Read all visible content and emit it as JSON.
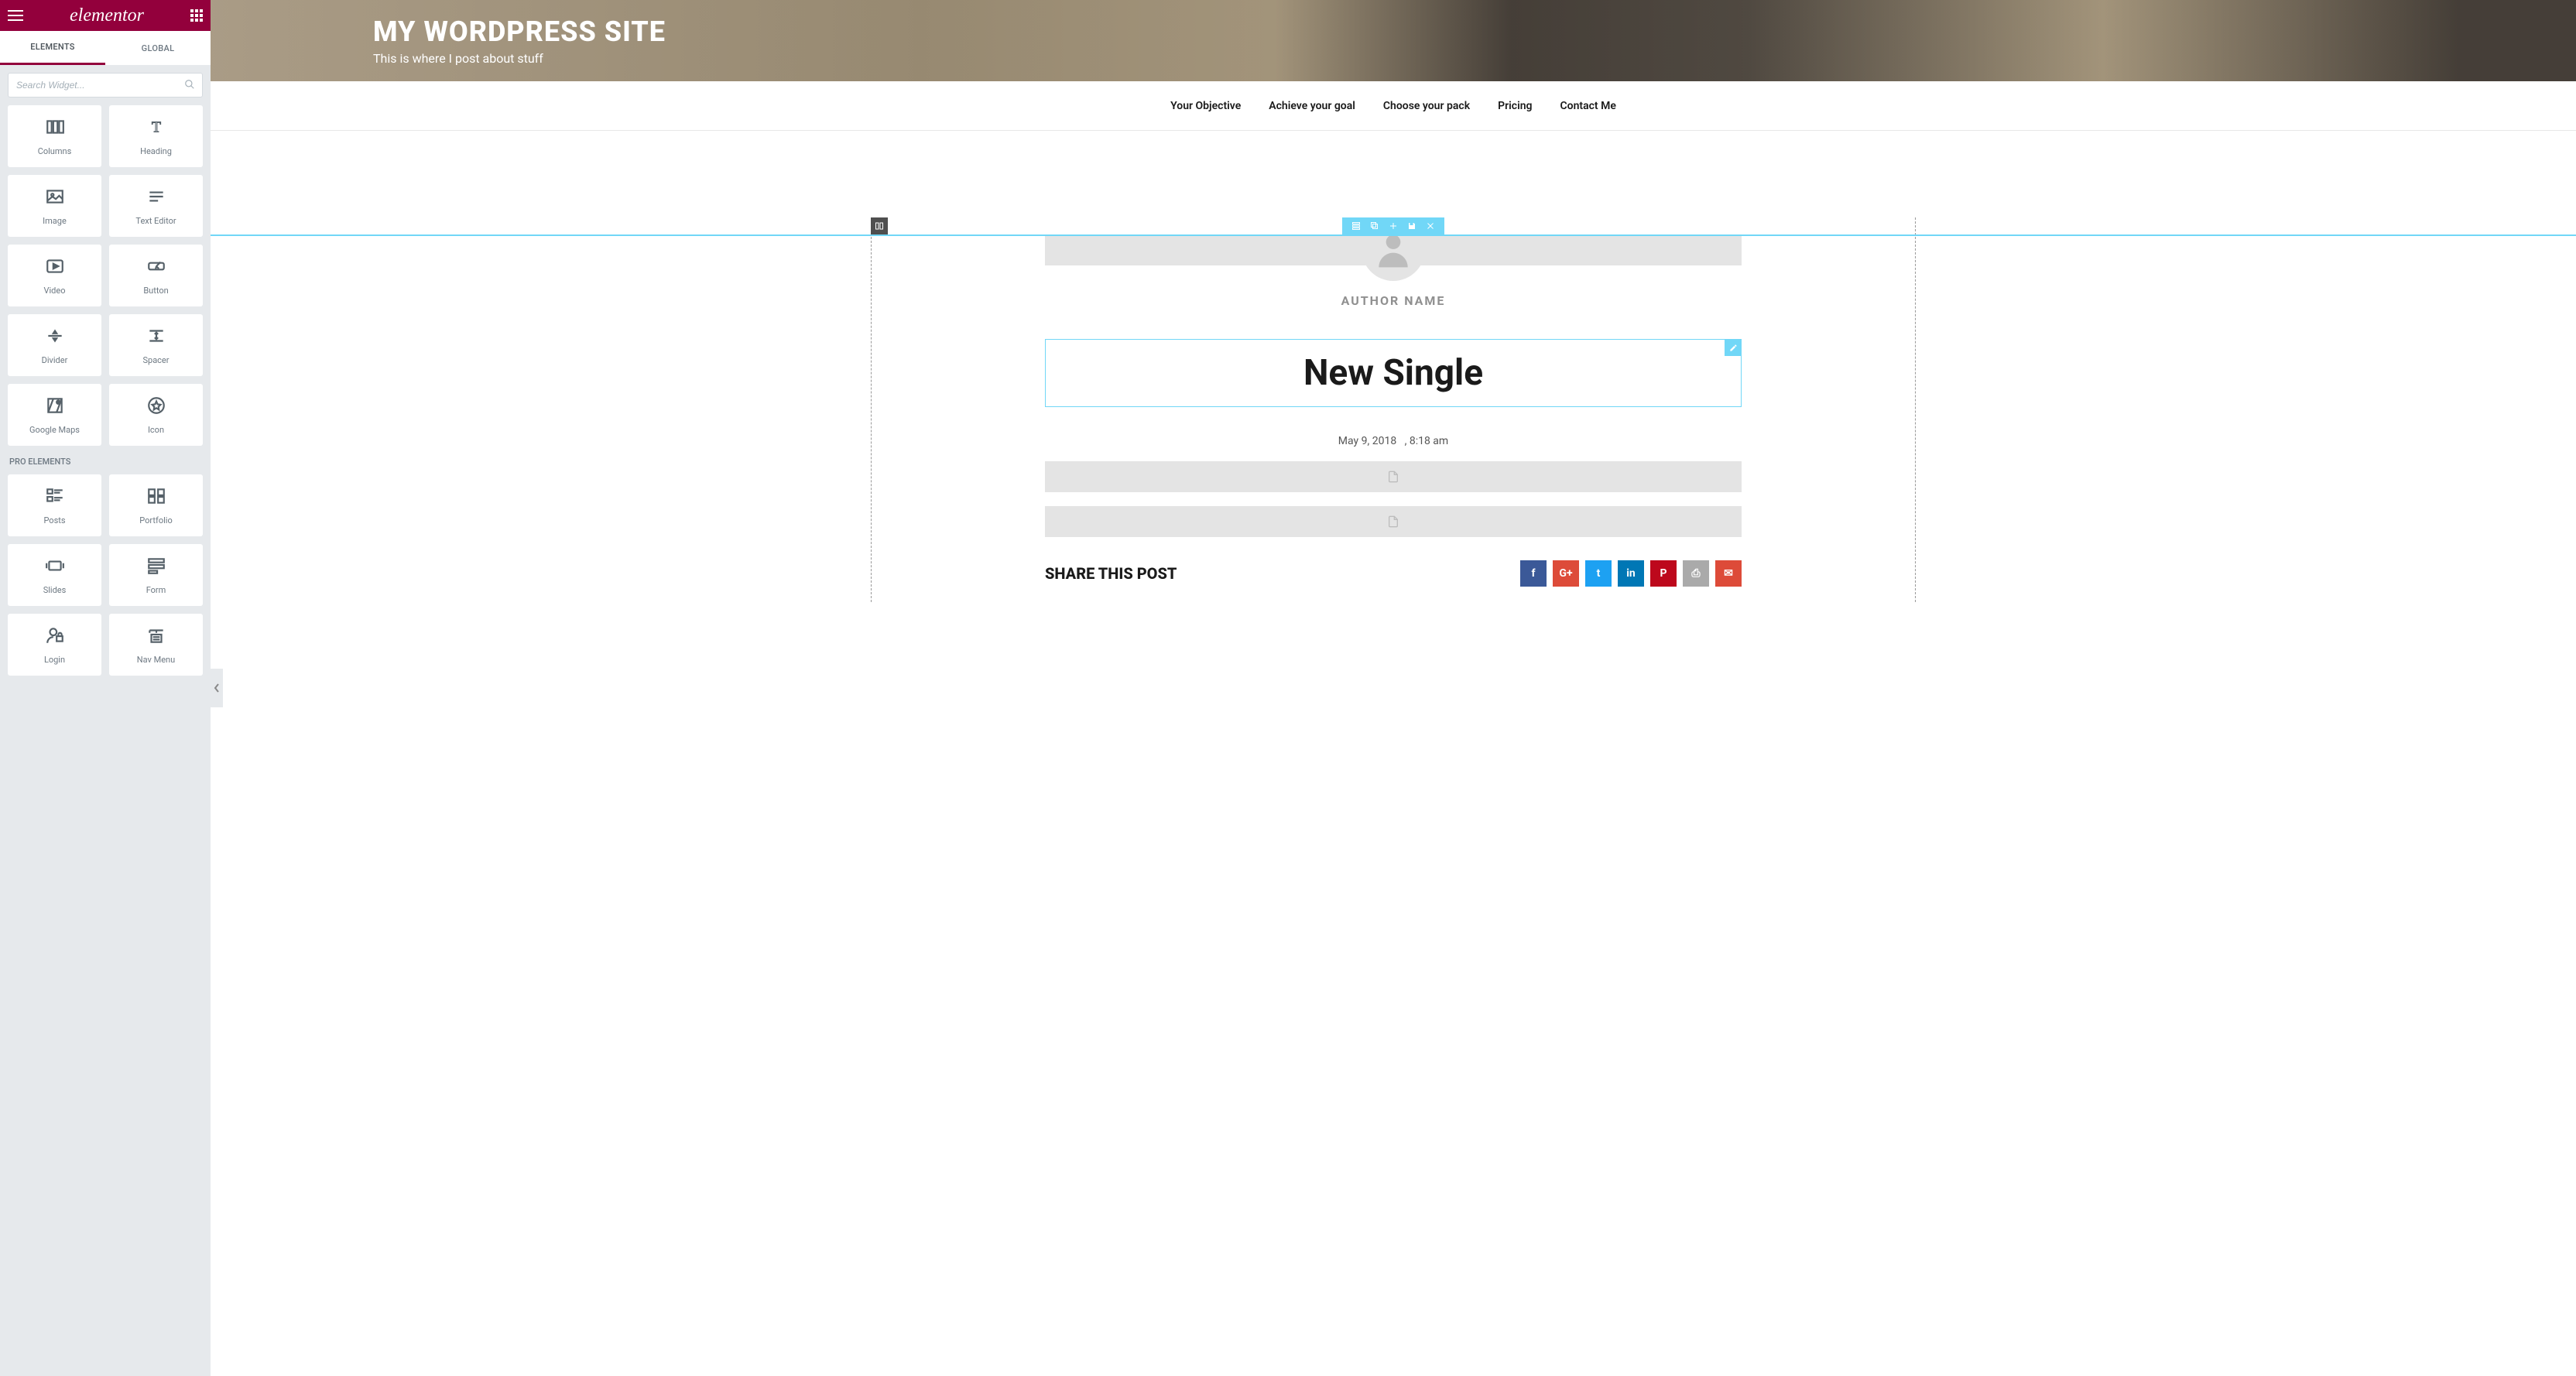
{
  "sidebar": {
    "logo": "elementor",
    "tabs": {
      "elements": "ELEMENTS",
      "global": "GLOBAL"
    },
    "search_placeholder": "Search Widget...",
    "basic_widgets": [
      {
        "label": "Columns",
        "icon": "columns"
      },
      {
        "label": "Heading",
        "icon": "heading"
      },
      {
        "label": "Image",
        "icon": "image"
      },
      {
        "label": "Text Editor",
        "icon": "text-editor"
      },
      {
        "label": "Video",
        "icon": "video"
      },
      {
        "label": "Button",
        "icon": "button"
      },
      {
        "label": "Divider",
        "icon": "divider"
      },
      {
        "label": "Spacer",
        "icon": "spacer"
      },
      {
        "label": "Google Maps",
        "icon": "google-maps"
      },
      {
        "label": "Icon",
        "icon": "icon"
      }
    ],
    "pro_section_title": "PRO ELEMENTS",
    "pro_widgets": [
      {
        "label": "Posts",
        "icon": "posts"
      },
      {
        "label": "Portfolio",
        "icon": "portfolio"
      },
      {
        "label": "Slides",
        "icon": "slides"
      },
      {
        "label": "Form",
        "icon": "form"
      },
      {
        "label": "Login",
        "icon": "login"
      },
      {
        "label": "Nav Menu",
        "icon": "nav-menu"
      }
    ]
  },
  "hero": {
    "title": "MY WORDPRESS SITE",
    "subtitle": "This is where I post about stuff"
  },
  "nav": {
    "items": [
      "Your Objective",
      "Achieve your goal",
      "Choose your pack",
      "Pricing",
      "Contact Me"
    ]
  },
  "post": {
    "author": "AUTHOR NAME",
    "title": "New Single",
    "date": "May 9, 2018",
    "time": "8:18 am",
    "share_heading": "SHARE THIS POST"
  },
  "share_buttons": [
    {
      "name": "facebook",
      "glyph": "f",
      "color": "#3b5998"
    },
    {
      "name": "google-plus",
      "glyph": "G+",
      "color": "#dd4b39"
    },
    {
      "name": "twitter",
      "glyph": "t",
      "color": "#1da1f2"
    },
    {
      "name": "linkedin",
      "glyph": "in",
      "color": "#0077b5"
    },
    {
      "name": "pinterest",
      "glyph": "P",
      "color": "#bd081c"
    },
    {
      "name": "print",
      "glyph": "⎙",
      "color": "#aaaaaa"
    },
    {
      "name": "email",
      "glyph": "✉",
      "color": "#dd4b39"
    }
  ]
}
